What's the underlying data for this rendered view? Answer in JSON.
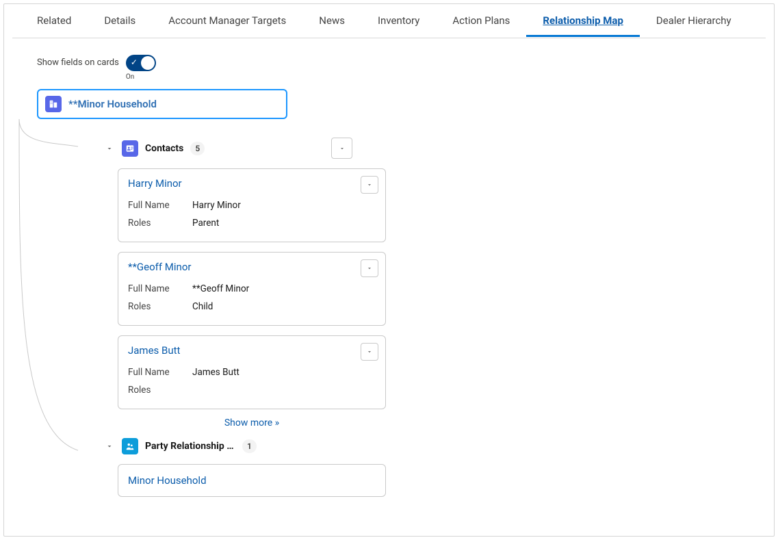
{
  "tabs": [
    {
      "label": "Related",
      "active": false
    },
    {
      "label": "Details",
      "active": false
    },
    {
      "label": "Account Manager Targets",
      "active": false
    },
    {
      "label": "News",
      "active": false
    },
    {
      "label": "Inventory",
      "active": false
    },
    {
      "label": "Action Plans",
      "active": false
    },
    {
      "label": "Relationship Map",
      "active": true
    },
    {
      "label": "Dealer Hierarchy",
      "active": false
    }
  ],
  "toggle": {
    "label": "Show fields on cards",
    "state_text": "On"
  },
  "root": {
    "title": "**Minor Household"
  },
  "contacts": {
    "title": "Contacts",
    "count": "5",
    "field_labels": {
      "full_name": "Full Name",
      "roles": "Roles"
    },
    "items": [
      {
        "name": "Harry Minor",
        "full_name": "Harry Minor",
        "roles": "Parent"
      },
      {
        "name": "**Geoff Minor",
        "full_name": "**Geoff Minor",
        "roles": "Child"
      },
      {
        "name": "James Butt",
        "full_name": "James Butt",
        "roles": ""
      }
    ],
    "show_more": "Show more »"
  },
  "party": {
    "title": "Party Relationship Groups",
    "count": "1",
    "items": [
      {
        "name": "Minor Household"
      }
    ]
  }
}
